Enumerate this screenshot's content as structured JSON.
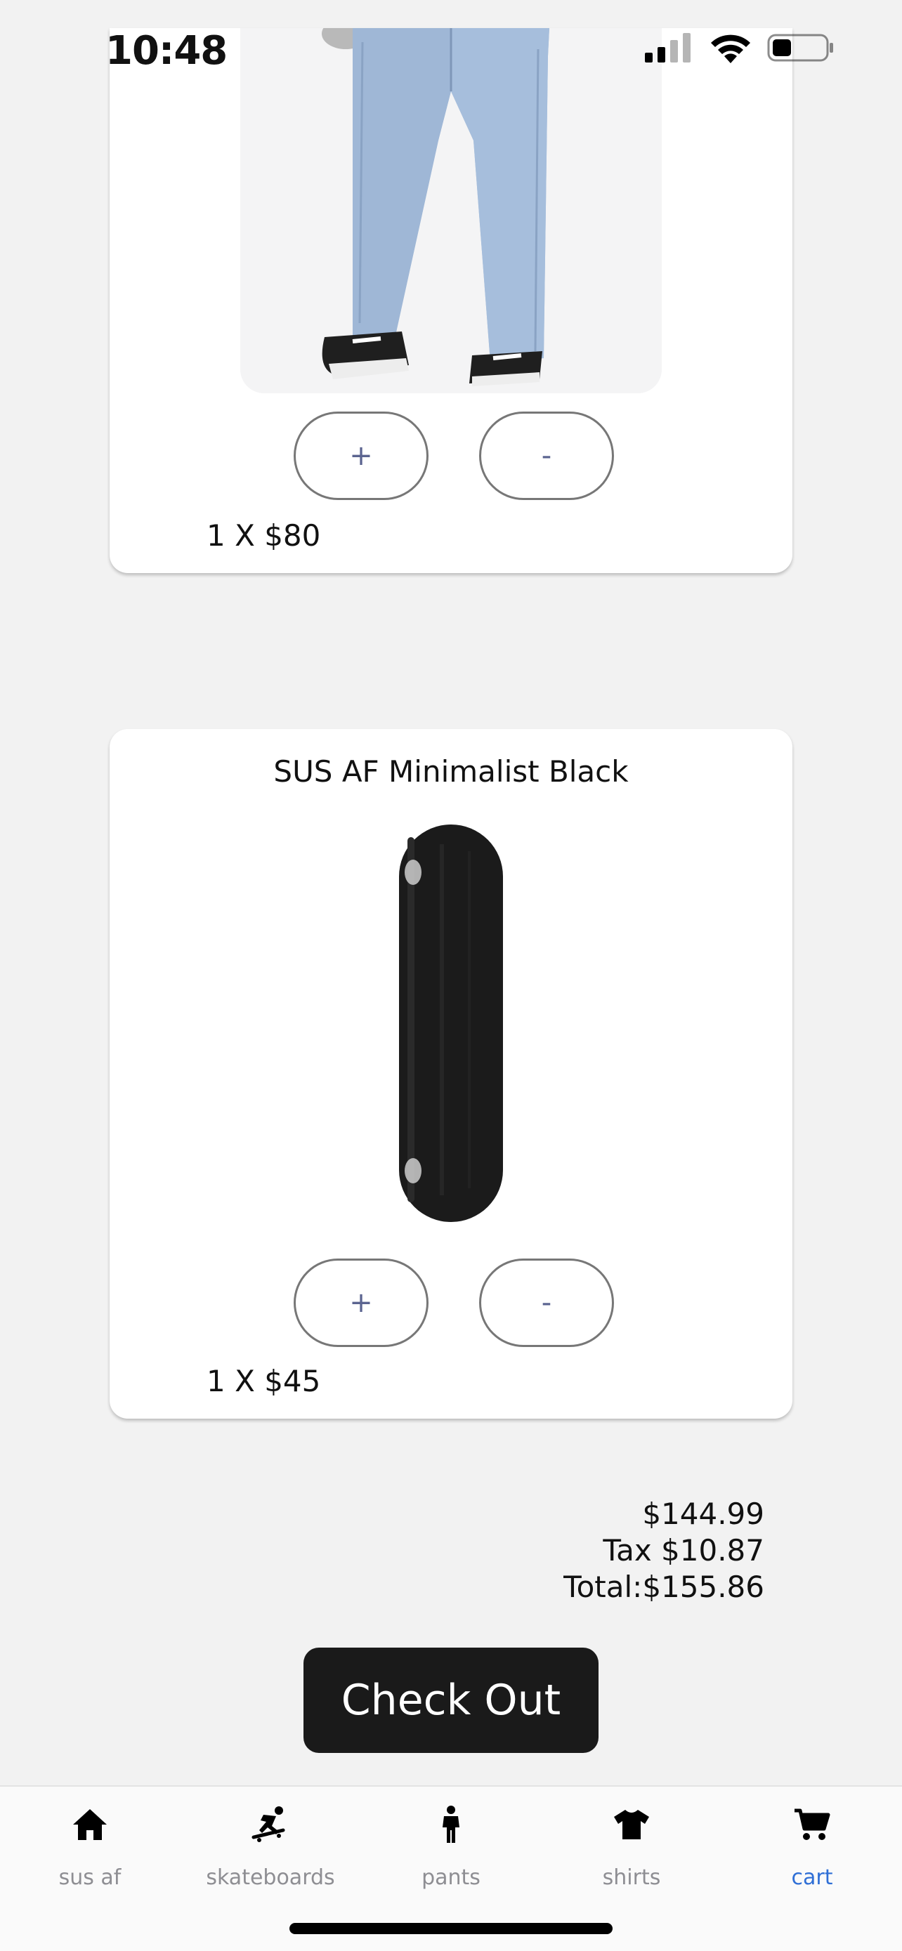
{
  "status_bar": {
    "time": "10:48"
  },
  "cart_items": [
    {
      "title": "",
      "plus_label": "+",
      "minus_label": "-",
      "quantity_line": "1 X $80"
    },
    {
      "title": "SUS AF Minimalist Black",
      "plus_label": "+",
      "minus_label": "-",
      "quantity_line": "1 X $45"
    }
  ],
  "summary": {
    "subtotal": "$144.99",
    "tax": "Tax $10.87",
    "total": "Total:$155.86"
  },
  "checkout_label": "Check Out",
  "tabs": [
    {
      "label": "sus af",
      "icon": "home-icon",
      "active": false
    },
    {
      "label": "skateboards",
      "icon": "skateboarder-icon",
      "active": false
    },
    {
      "label": "pants",
      "icon": "person-icon",
      "active": false
    },
    {
      "label": "shirts",
      "icon": "tshirt-icon",
      "active": false
    },
    {
      "label": "cart",
      "icon": "cart-icon",
      "active": true
    }
  ],
  "colors": {
    "active_tab": "#2f6fd6",
    "inactive_tab": "#8e8e93",
    "checkout_bg": "#1a1a1a"
  }
}
